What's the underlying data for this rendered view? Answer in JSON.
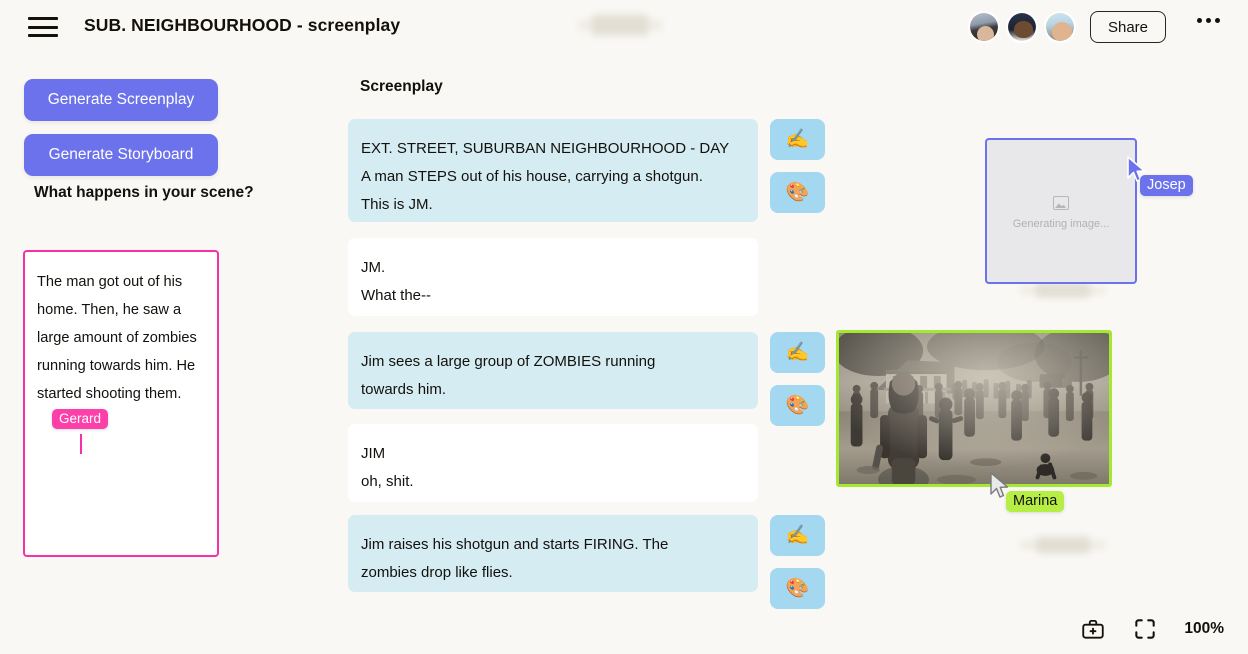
{
  "header": {
    "menu_icon": "hamburger-icon",
    "title": "SUB. NEIGHBOURHOOD - screenplay",
    "share_label": "Share",
    "more_icon": "ellipsis-icon",
    "avatars": [
      {
        "name": "collaborator-1",
        "ring": "#ff3fb0"
      },
      {
        "name": "collaborator-2",
        "ring": "#6b72ec"
      },
      {
        "name": "collaborator-3",
        "ring": "#a4e832"
      }
    ]
  },
  "sidebar": {
    "generate_screenplay_label": "Generate Screenplay",
    "generate_storyboard_label": "Generate Storyboard",
    "prompt_label": "What happens in your scene?",
    "prompt_value": "The man got out of his home. Then, he saw a large amount of zombies running towards him. He started shooting them.",
    "prompt_border_color": "#f72fa8",
    "cursor_tag": "Gerard",
    "cursor_tag_color": "#fc3fa9"
  },
  "screenplay": {
    "title": "Screenplay",
    "blocks": [
      {
        "type": "action",
        "text": "EXT. STREET, SUBURBAN NEIGHBOURHOOD - DAY\nA man STEPS out of his house, carrying a shotgun.\nThis is JM.",
        "has_actions": true
      },
      {
        "type": "dialog",
        "text": "JM.\nWhat the--",
        "has_actions": false
      },
      {
        "type": "action",
        "text": "Jim sees a large group of ZOMBIES running\ntowards him.",
        "has_actions": true
      },
      {
        "type": "dialog",
        "text": "JIM\noh, shit.",
        "has_actions": false
      },
      {
        "type": "action",
        "text": "Jim raises his shotgun and starts FIRING. The\nzombies drop like flies.",
        "has_actions": true
      }
    ],
    "action_buttons": [
      {
        "name": "rewrite-button",
        "glyph": "✍️"
      },
      {
        "name": "illustrate-button",
        "glyph": "🎨"
      }
    ]
  },
  "canvas": {
    "generating_card": {
      "status_text": "Generating image...",
      "border_color": "#6b72ec",
      "cursor_tag": "Josep",
      "cursor_tag_color": "#6b72ec"
    },
    "image_card": {
      "alt": "black and white illustration of a crowd of zombies walking down a suburban street",
      "border_color": "#a4e832",
      "cursor_tag": "Marina",
      "cursor_tag_color": "#b6ee45"
    }
  },
  "bottom_bar": {
    "toolbox_icon": "toolbox-icon",
    "fit_icon": "fit-to-screen-icon",
    "zoom_level": "100%"
  }
}
